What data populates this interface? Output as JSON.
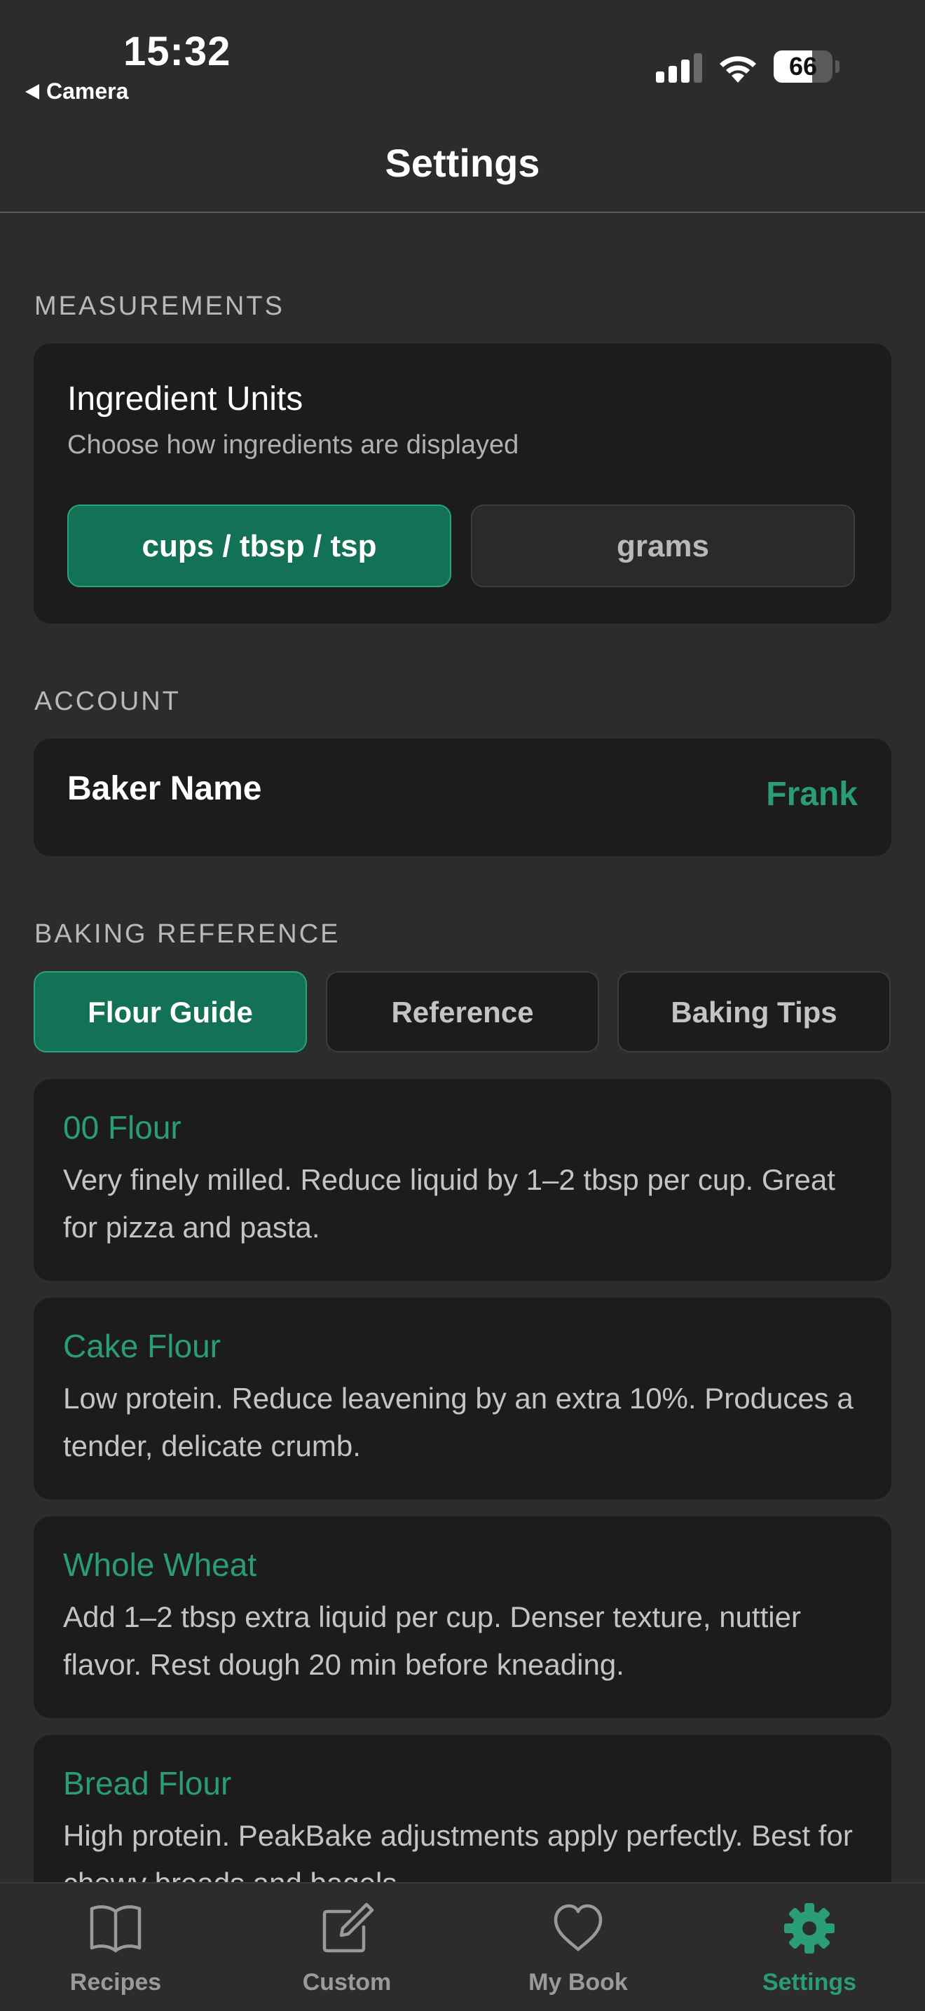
{
  "status_bar": {
    "time": "15:32",
    "back_app": "Camera",
    "battery_level": "66",
    "battery_fraction": 0.66,
    "icons": [
      "signal-icon",
      "wifi-icon",
      "battery-icon"
    ]
  },
  "header": {
    "title": "Settings"
  },
  "measurements": {
    "section_label": "MEASUREMENTS",
    "title": "Ingredient Units",
    "subtitle": "Choose how ingredients are displayed",
    "options": [
      "cups / tbsp / tsp",
      "grams"
    ],
    "selected": "cups / tbsp / tsp"
  },
  "account": {
    "section_label": "ACCOUNT",
    "baker_name_label": "Baker Name",
    "baker_name_value": "Frank"
  },
  "baking_reference": {
    "section_label": "BAKING REFERENCE",
    "tabs": [
      "Flour Guide",
      "Reference",
      "Baking Tips"
    ],
    "active_tab": "Flour Guide",
    "items": [
      {
        "title": "00 Flour",
        "description": "Very finely milled. Reduce liquid by 1–2 tbsp per cup. Great for pizza and pasta."
      },
      {
        "title": "Cake Flour",
        "description": "Low protein. Reduce leavening by an extra 10%. Produces a tender, delicate crumb."
      },
      {
        "title": "Whole Wheat",
        "description": "Add 1–2 tbsp extra liquid per cup. Denser texture, nuttier flavor. Rest dough 20 min before kneading."
      },
      {
        "title": "Bread Flour",
        "description": "High protein. PeakBake adjustments apply perfectly. Best for chewy breads and bagels."
      }
    ]
  },
  "tab_bar": {
    "items": [
      {
        "label": "Recipes",
        "icon": "book-icon"
      },
      {
        "label": "Custom",
        "icon": "edit-icon"
      },
      {
        "label": "My Book",
        "icon": "heart-icon"
      },
      {
        "label": "Settings",
        "icon": "gear-icon"
      }
    ],
    "active": "Settings"
  },
  "colors": {
    "background": "#2c2c2c",
    "card": "#1c1c1c",
    "accent": "#2a9d74",
    "accent_fill": "#137256",
    "muted_text": "#b9b9b9"
  }
}
